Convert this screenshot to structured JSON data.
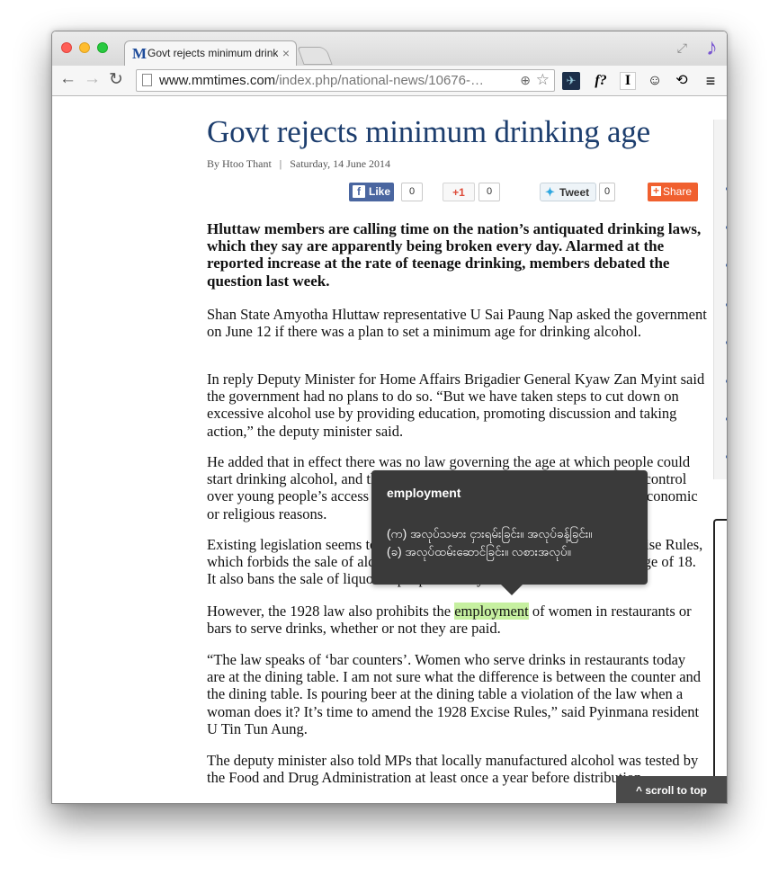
{
  "browser": {
    "tab_title": "Govt rejects minimum drinking age",
    "tab_favicon": "M",
    "tab_close": "×",
    "url_host": "www.mmtimes.com",
    "url_rest": "/index.php/national-news/10676-…",
    "ext_f_label": "f?",
    "ext_i_label": "I"
  },
  "article": {
    "headline": "Govt rejects minimum drinking age",
    "author": "By Htoo Thant",
    "separator": "|",
    "date": "Saturday, 14 June 2014",
    "share": {
      "fb_label": "Like",
      "fb_count": "0",
      "gplus_label": "+1",
      "gplus_count": "0",
      "tweet_label": "Tweet",
      "tweet_count": "0",
      "share_label": "Share"
    },
    "lead": "Hluttaw members are calling time on the nation’s antiquated drinking laws, which they say are apparently being broken every day. Alarmed at the reported increase at the rate of teenage drinking, members debated the question last week.",
    "p1": "Shan State Amyotha Hluttaw representative U Sai Paung Nap asked the government on June 12 if there was a plan to set a minimum age for drinking alcohol.",
    "p2": "In reply Deputy Minister for Home Affairs Brigadier General Kyaw Zan Myint said the government had no plans to do so. “But we have taken steps to cut down on excessive alcohol use by providing education, promoting discussion and taking action,” the deputy minister said.",
    "p3": "He added that in effect there was no law governing the age at which people could start drinking alcohol, and that only parents and guardians could exercise control over young people’s access to and consumption of alcohol, citing social, economic or religious reasons.",
    "p4": "Existing legislation seems to have little impact. Section 8 of the 1928 Excise Rules, which forbids the sale of alcohol to anyone who appears to be under the age of 18. It also bans the sale of liquor to people already drunk.",
    "p5_before": "However, the 1928 law also prohibits the ",
    "p5_highlight": "employment",
    "p5_after": " of women in restaurants or bars to serve drinks, whether or not they are paid.",
    "p6": "“The law speaks of ‘bar counters’. Women who serve drinks in restaurants today are at the dining table. I am not sure what the difference is between the counter and the dining table. Is pouring beer at the dining table a violation of the law when a woman does it? It’s time to amend the 1928 Excise Rules,” said Pyinmana resident U Tin Tun Aung.",
    "p7": "The deputy minister also told MPs that locally manufactured alcohol was tested by the Food and Drug Administration at least once a year before distribution."
  },
  "tooltip": {
    "word": "employment",
    "def_line1": "(က) အလုပ်သမား ငှားရမ်းခြင်း။ အလုပ်ခန့်ခြင်း။",
    "def_line2": "(ခ) အလုပ်ထမ်းဆောင်ခြင်း။ လစားအလုပ်။"
  },
  "scroll_to_top": "^ scroll to top",
  "colors": {
    "headline": "#1d3e6e",
    "highlight": "#c6f0a0",
    "tooltip_bg": "#3a3a3a",
    "facebook": "#4a66a0",
    "share": "#f0602f"
  }
}
